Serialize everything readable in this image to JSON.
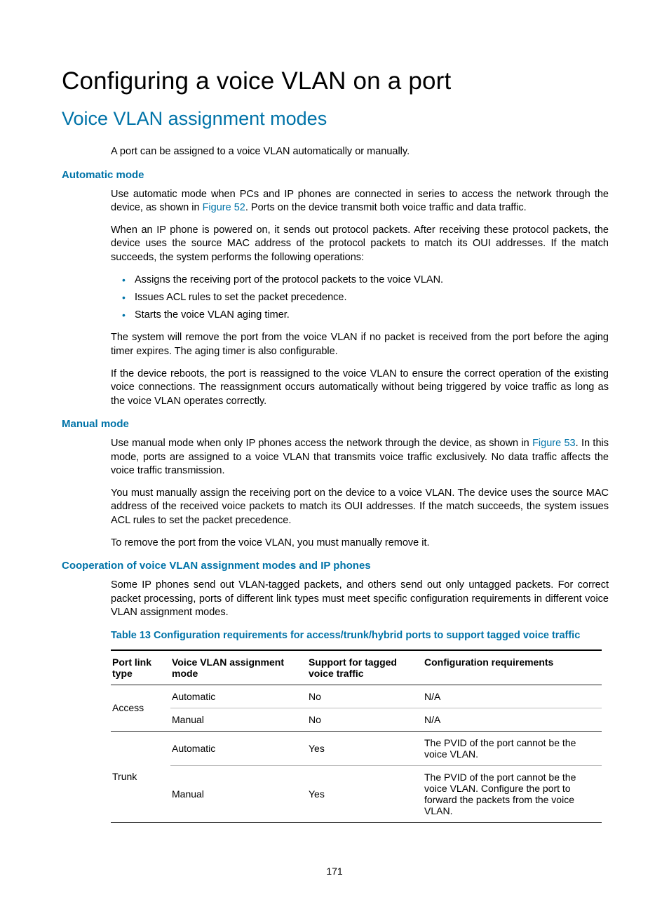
{
  "page_number": "171",
  "title": "Configuring a voice VLAN on a port",
  "section_title": "Voice VLAN assignment modes",
  "intro_para": "A port can be assigned to a voice VLAN automatically or manually.",
  "auto": {
    "heading": "Automatic mode",
    "p1_a": "Use automatic mode when PCs and IP phones are connected in series to access the network through the device, as shown in ",
    "p1_link": "Figure 52",
    "p1_b": ". Ports on the device transmit both voice traffic and data traffic.",
    "p2": "When an IP phone is powered on, it sends out protocol packets. After receiving these protocol packets, the device uses the source MAC address of the protocol packets to match its OUI addresses. If the match succeeds, the system performs the following operations:",
    "bullets": [
      "Assigns the receiving port of the protocol packets to the voice VLAN.",
      "Issues ACL rules to set the packet precedence.",
      "Starts the voice VLAN aging timer."
    ],
    "p3": "The system will remove the port from the voice VLAN if no packet is received from the port before the aging timer expires. The aging timer is also configurable.",
    "p4": "If the device reboots, the port is reassigned to the voice VLAN to ensure the correct operation of the existing voice connections. The reassignment occurs automatically without being triggered by voice traffic as long as the voice VLAN operates correctly."
  },
  "manual": {
    "heading": "Manual mode",
    "p1_a": "Use manual mode when only IP phones access the network through the device, as shown in ",
    "p1_link": "Figure 53",
    "p1_b": ". In this mode, ports are assigned to a voice VLAN that transmits voice traffic exclusively. No data traffic affects the voice traffic transmission.",
    "p2": "You must manually assign the receiving port on the device to a voice VLAN. The device uses the source MAC address of the received voice packets to match its OUI addresses. If the match succeeds, the system issues ACL rules to set the packet precedence.",
    "p3": "To remove the port from the voice VLAN, you must manually remove it."
  },
  "coop": {
    "heading": "Cooperation of voice VLAN assignment modes and IP phones",
    "p1": "Some IP phones send out VLAN-tagged packets, and others send out only untagged packets. For correct packet processing, ports of different link types must meet specific configuration requirements in different voice VLAN assignment modes."
  },
  "table": {
    "caption": "Table 13 Configuration requirements for access/trunk/hybrid ports to support tagged voice traffic",
    "headers": {
      "linktype": "Port link type",
      "mode": "Voice VLAN assignment mode",
      "support": "Support for tagged voice traffic",
      "req": "Configuration requirements"
    },
    "rows": {
      "access_label": "Access",
      "access_auto": {
        "mode": "Automatic",
        "support": "No",
        "req": "N/A"
      },
      "access_manual": {
        "mode": "Manual",
        "support": "No",
        "req": "N/A"
      },
      "trunk_label": "Trunk",
      "trunk_auto": {
        "mode": "Automatic",
        "support": "Yes",
        "req": "The PVID of the port cannot be the voice VLAN."
      },
      "trunk_manual": {
        "mode": "Manual",
        "support": "Yes",
        "req": "The PVID of the port cannot be the voice VLAN. Configure the port to forward the packets from the voice VLAN."
      }
    }
  }
}
